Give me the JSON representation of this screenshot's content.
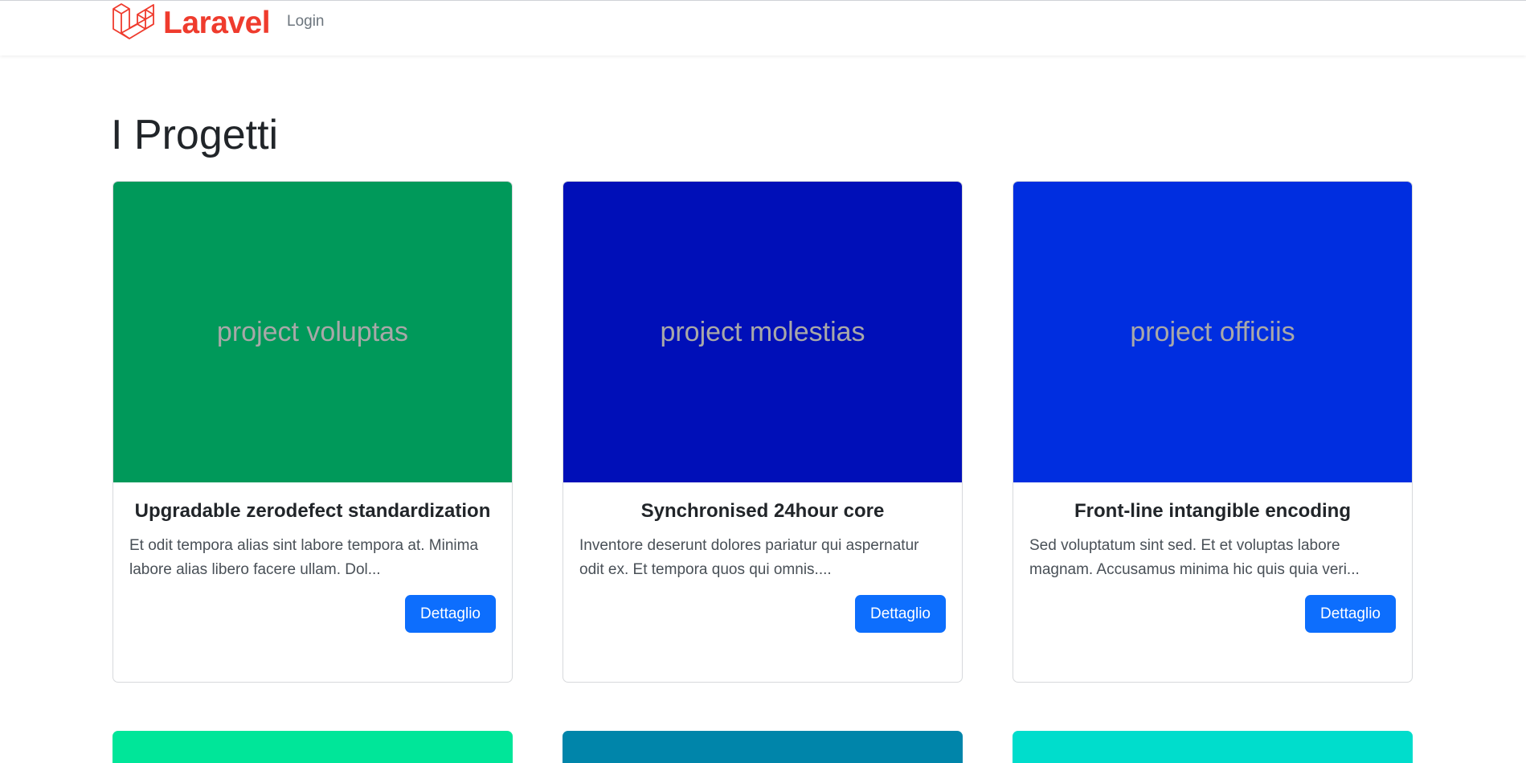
{
  "nav": {
    "brand": "Laravel",
    "login": "Login",
    "brand_color": "#ef3b2d"
  },
  "page": {
    "title": "I Progetti"
  },
  "projects": [
    {
      "image_label": "project voluptas",
      "image_color": "#00995a",
      "title": "Upgradable zerodefect standardization",
      "excerpt": "Et odit tempora alias sint labore tempora at. Minima labore alias libero facere ullam. Dol...",
      "button": "Dettaglio"
    },
    {
      "image_label": "project molestias",
      "image_color": "#000fb8",
      "title": "Synchronised 24hour core",
      "excerpt": "Inventore deserunt dolores pariatur qui aspernatur odit ex. Et tempora quos qui omnis....",
      "button": "Dettaglio"
    },
    {
      "image_label": "project officiis",
      "image_color": "#002ee0",
      "title": "Front-line intangible encoding",
      "excerpt": "Sed voluptatum sint sed. Et et voluptas labore magnam. Accusamus minima hic quis quia veri...",
      "button": "Dettaglio"
    }
  ],
  "next_row_colors": [
    "#00e699",
    "#0085aa",
    "#00ddcc"
  ],
  "button_color": "#0d6efd"
}
